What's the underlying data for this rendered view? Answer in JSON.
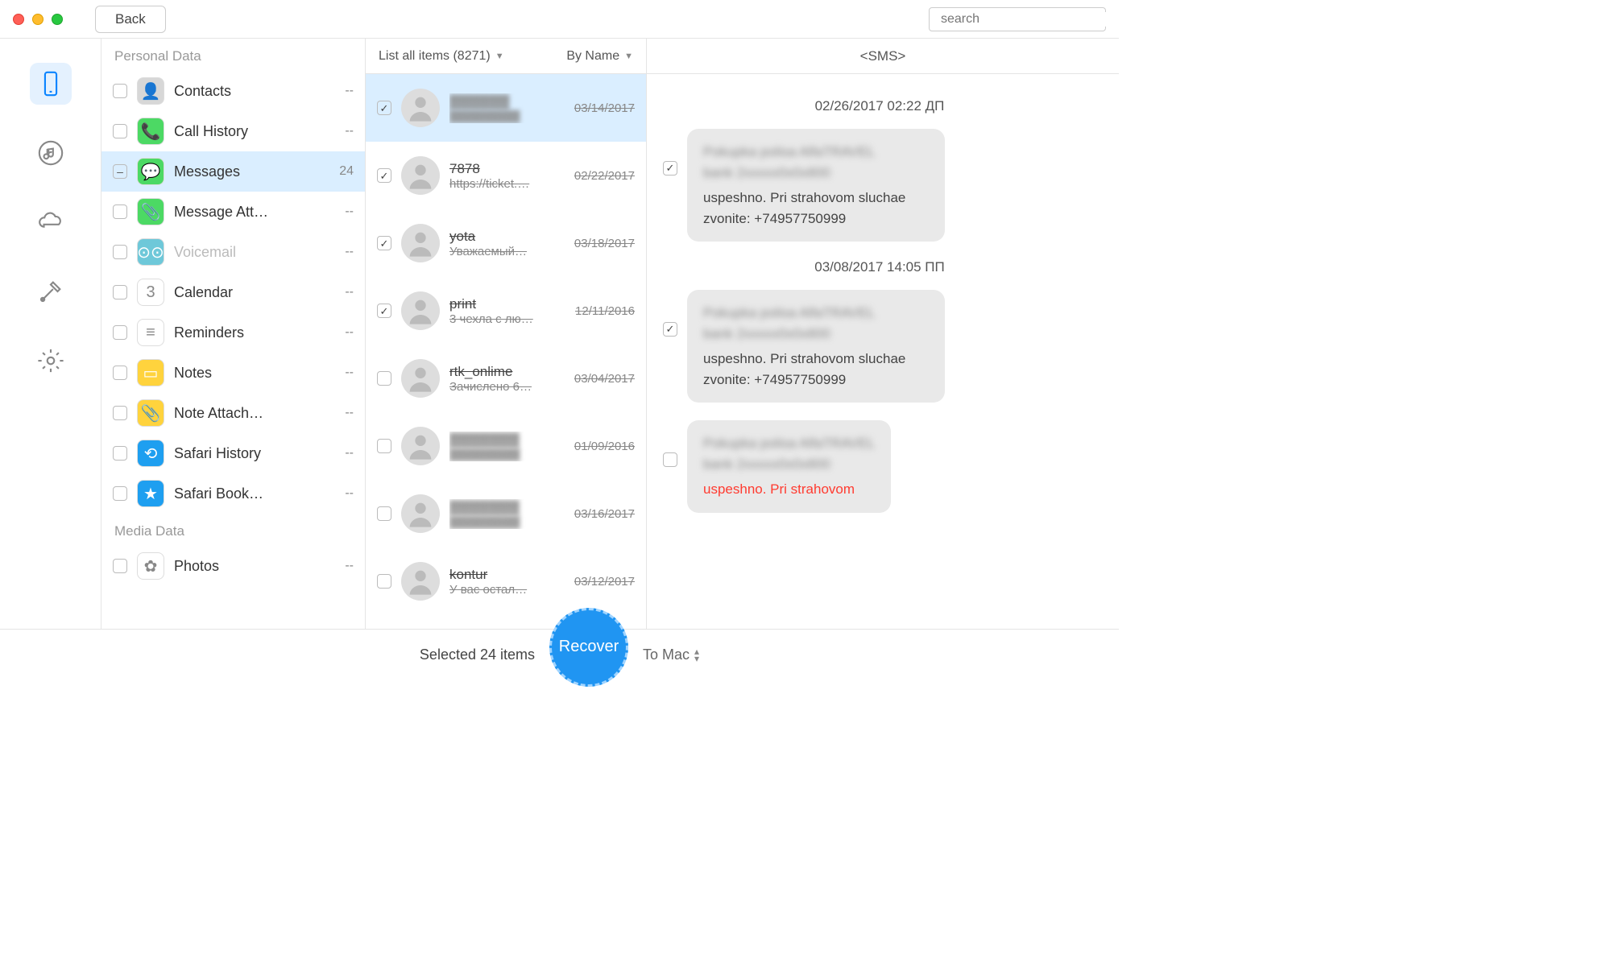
{
  "titlebar": {
    "back": "Back",
    "search_placeholder": "search"
  },
  "rail": [
    {
      "name": "device-icon",
      "active": true
    },
    {
      "name": "music-icon",
      "active": false
    },
    {
      "name": "cloud-icon",
      "active": false
    },
    {
      "name": "tools-icon",
      "active": false
    },
    {
      "name": "settings-icon",
      "active": false
    }
  ],
  "categories": {
    "section1": "Personal Data",
    "section2": "Media Data",
    "items": [
      {
        "label": "Contacts",
        "count": "--",
        "checked": "",
        "sel": false,
        "icon_bg": "#d7d7d7"
      },
      {
        "label": "Call History",
        "count": "--",
        "checked": "",
        "sel": false,
        "icon_bg": "#4cd964"
      },
      {
        "label": "Messages",
        "count": "24",
        "checked": "minus",
        "sel": true,
        "icon_bg": "#4cd964"
      },
      {
        "label": "Message Att…",
        "count": "--",
        "checked": "",
        "sel": false,
        "icon_bg": "#4cd964"
      },
      {
        "label": "Voicemail",
        "count": "--",
        "checked": "",
        "sel": false,
        "disabled": true,
        "icon_bg": "#6ec8d9"
      },
      {
        "label": "Calendar",
        "count": "--",
        "checked": "",
        "sel": false,
        "icon_bg": "#fff"
      },
      {
        "label": "Reminders",
        "count": "--",
        "checked": "",
        "sel": false,
        "icon_bg": "#fff"
      },
      {
        "label": "Notes",
        "count": "--",
        "checked": "",
        "sel": false,
        "icon_bg": "#ffd33d"
      },
      {
        "label": "Note Attach…",
        "count": "--",
        "checked": "",
        "sel": false,
        "icon_bg": "#ffd33d"
      },
      {
        "label": "Safari History",
        "count": "--",
        "checked": "",
        "sel": false,
        "icon_bg": "#1e9ff0"
      },
      {
        "label": "Safari Book…",
        "count": "--",
        "checked": "",
        "sel": false,
        "icon_bg": "#1e9ff0"
      }
    ],
    "media": [
      {
        "label": "Photos",
        "count": "--",
        "checked": "",
        "icon_bg": "#fff"
      }
    ]
  },
  "threads": {
    "filter": "List all items (8271)",
    "sort": "By Name",
    "rows": [
      {
        "name": "▓▓▓▓▓▓",
        "snip": "▓▓▓▓▓▓▓▓",
        "date": "03/14/2017",
        "checked": true,
        "sel": true,
        "blur": true
      },
      {
        "name": "7878",
        "snip": "https://ticket.…",
        "date": "02/22/2017",
        "checked": true
      },
      {
        "name": "yota",
        "snip": "Уважаемый…",
        "date": "03/18/2017",
        "checked": true
      },
      {
        "name": "print",
        "snip": "3 чехла с лю…",
        "date": "12/11/2016",
        "checked": true
      },
      {
        "name": "rtk_onlime",
        "snip": "Зачислено 6…",
        "date": "03/04/2017",
        "checked": false
      },
      {
        "name": "▓▓▓▓▓▓▓",
        "snip": "▓▓▓▓▓▓▓▓",
        "date": "01/09/2016",
        "checked": false,
        "blur": true
      },
      {
        "name": "▓▓▓▓▓▓▓",
        "snip": "▓▓▓▓▓▓▓▓",
        "date": "03/16/2017",
        "checked": false,
        "blur": true
      },
      {
        "name": "kontur",
        "snip": "У вас остал…",
        "date": "03/12/2017",
        "checked": false
      }
    ]
  },
  "conversation": {
    "title": "<SMS>",
    "blocks": [
      {
        "type": "date",
        "text": "02/26/2017 02:22 ДП"
      },
      {
        "type": "msg",
        "checked": true,
        "text": "uspeshno. Pri strahovom sluchae zvonite: +74957750999"
      },
      {
        "type": "date",
        "text": "03/08/2017 14:05 ПП"
      },
      {
        "type": "msg",
        "checked": true,
        "text": "uspeshno. Pri strahovom sluchae zvonite: +74957750999"
      },
      {
        "type": "msg",
        "checked": false,
        "red": true,
        "text": "uspeshno. Pri strahovom",
        "partial": true
      }
    ]
  },
  "footer": {
    "selected": "Selected 24 items",
    "recover": "Recover",
    "dest": "To Mac"
  }
}
